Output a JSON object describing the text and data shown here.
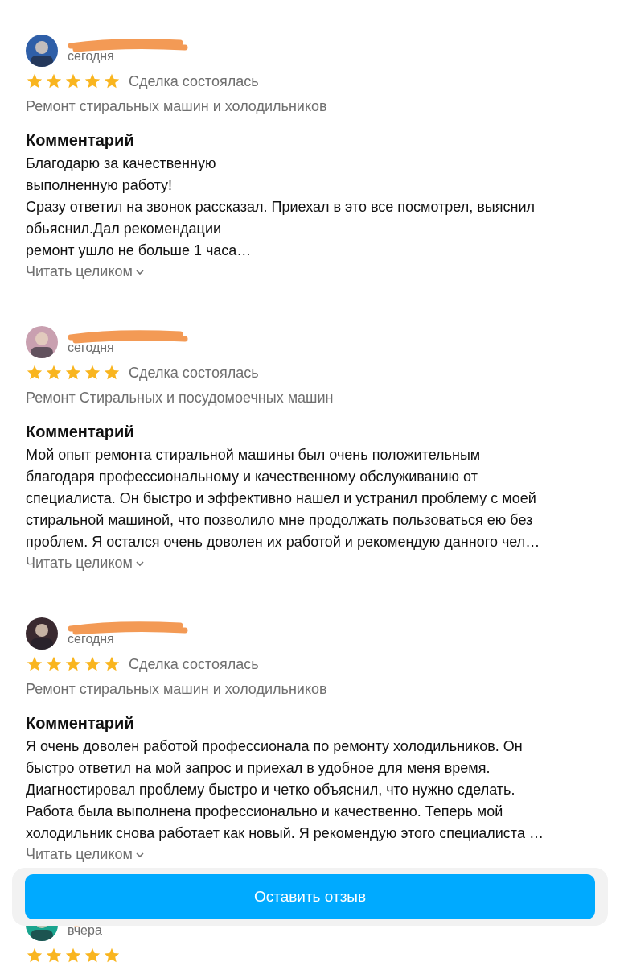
{
  "reviews": [
    {
      "date": "сегодня",
      "stars": 5,
      "deal": "Сделка состоялась",
      "service": "Ремонт стиральных машин и холодильников",
      "comment_title": "Комментарий",
      "comment": "Благодарю за качественную\nвыполненную работу!\nСразу ответил на звонок рассказал. Приехал в это все посмотрел, выяснил\nобьяснил.Дал рекомендации\nремонт ушло не больше 1 часа…",
      "read_more": "Читать целиком"
    },
    {
      "date": "сегодня",
      "stars": 5,
      "deal": "Сделка состоялась",
      "service": "Ремонт Стиральных и посудомоечных машин",
      "comment_title": "Комментарий",
      "comment": "Мой опыт ремонта стиральной машины был очень положительным\nблагодаря профессиональному и качественному обслуживанию от\nспециалиста. Он быстро и эффективно нашел и устранил проблему с моей\nстиральной машиной, что позволило мне продолжать пользоваться ею без\nпроблем. Я остался очень доволен их работой и рекомендую данного чел…",
      "read_more": "Читать целиком"
    },
    {
      "date": "сегодня",
      "stars": 5,
      "deal": "Сделка состоялась",
      "service": "Ремонт стиральных машин и холодильников",
      "comment_title": "Комментарий",
      "comment": "Я очень доволен работой профессионала по ремонту холодильников. Он\nбыстро ответил на мой запрос и приехал в удобное для меня время.\nДиагностировал проблему быстро и четко объяснил, что нужно сделать.\nРабота была выполнена профессионально и качественно. Теперь мой\nхолодильник снова работает как новый. Я рекомендую этого специалиста …",
      "read_more": "Читать целиком"
    },
    {
      "date": "вчера",
      "stars": 5
    }
  ],
  "leave_review_button": "Оставить отзыв"
}
